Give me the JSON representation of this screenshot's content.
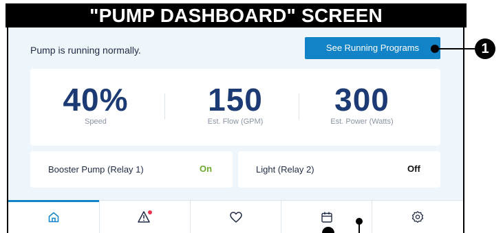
{
  "header": {
    "title": "\"PUMP DASHBOARD\" SCREEN"
  },
  "status": {
    "message": "Pump is running normally."
  },
  "actions": {
    "see_running_programs": "See Running Programs"
  },
  "metrics": [
    {
      "value": "40%",
      "label": "Speed"
    },
    {
      "value": "150",
      "label": "Est. Flow (GPM)"
    },
    {
      "value": "300",
      "label": "Est. Power (Watts)"
    }
  ],
  "relays": [
    {
      "label": "Booster Pump (Relay 1)",
      "state": "On",
      "state_color": "#6aa82e"
    },
    {
      "label": "Light (Relay 2)",
      "state": "Off",
      "state_color": "#111111"
    }
  ],
  "nav": [
    {
      "icon": "home-icon",
      "active": true
    },
    {
      "icon": "alert-icon",
      "badge": true
    },
    {
      "icon": "heart-icon"
    },
    {
      "icon": "calendar-icon"
    },
    {
      "icon": "settings-icon"
    }
  ],
  "callout": {
    "number": "1"
  },
  "colors": {
    "accent": "#1283c6",
    "navy": "#1c3a73",
    "on": "#6aa82e",
    "alert_badge": "#e8344e"
  }
}
